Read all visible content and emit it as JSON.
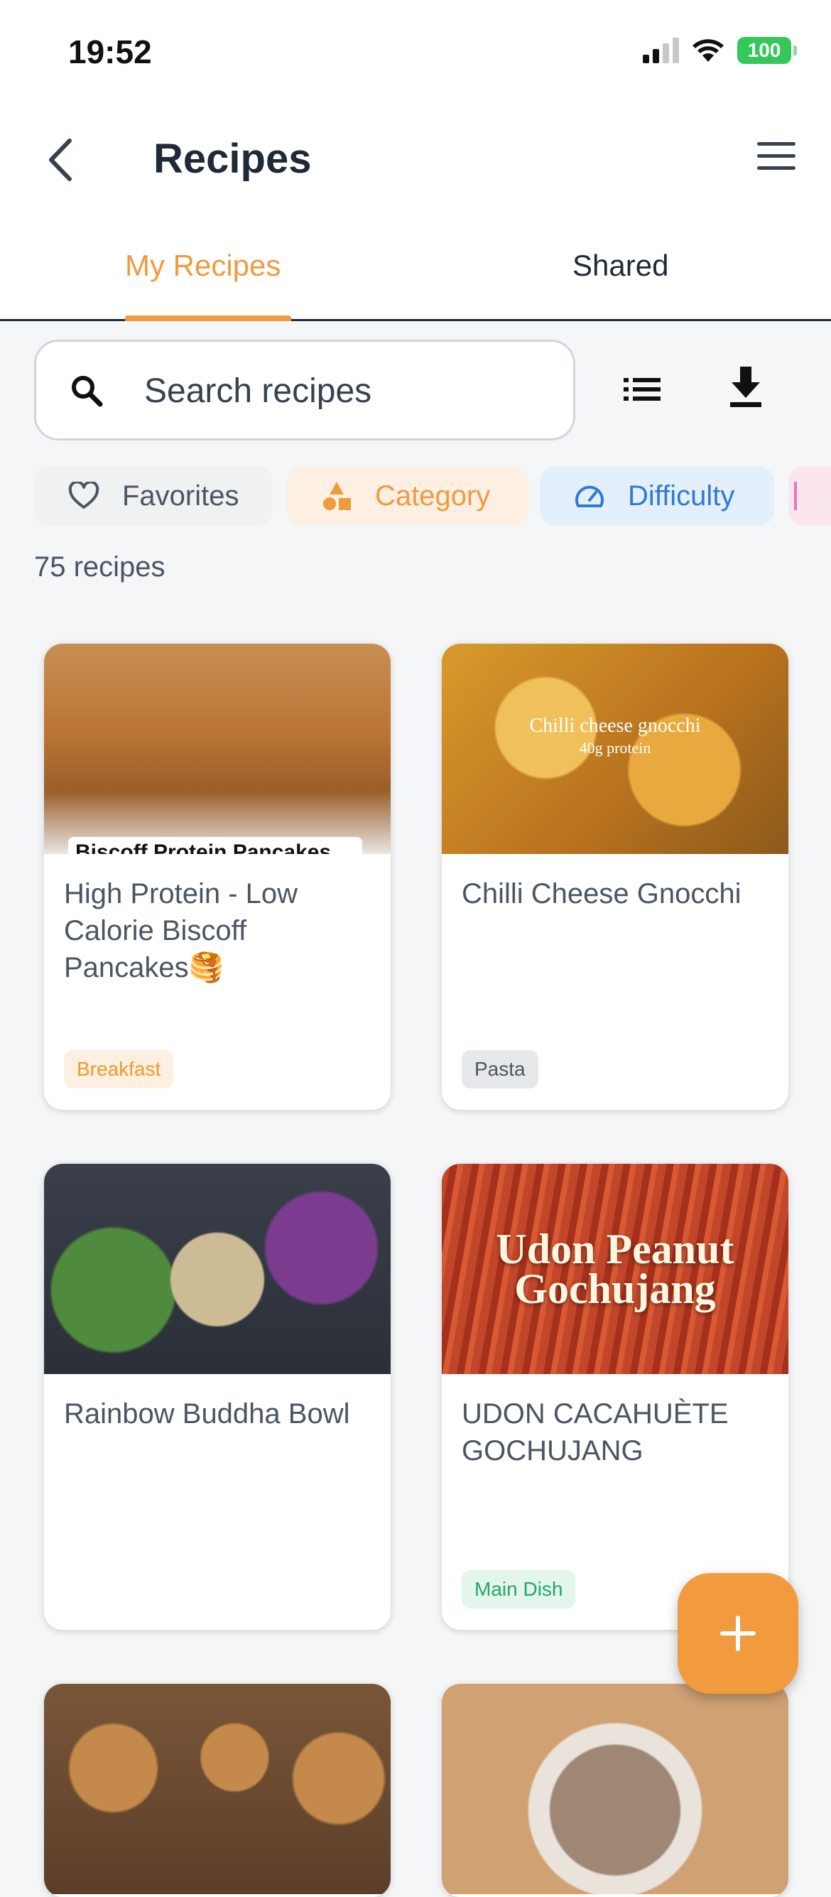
{
  "status_bar": {
    "time": "19:52",
    "battery": "100"
  },
  "header": {
    "title": "Recipes"
  },
  "tabs": [
    {
      "label": "My Recipes",
      "active": true
    },
    {
      "label": "Shared",
      "active": false
    }
  ],
  "search": {
    "placeholder": "Search recipes"
  },
  "filters": [
    {
      "label": "Favorites",
      "icon": "heart-icon"
    },
    {
      "label": "Category",
      "icon": "shapes-icon"
    },
    {
      "label": "Difficulty",
      "icon": "gauge-icon"
    }
  ],
  "recipe_count": "75 recipes",
  "recipes": [
    {
      "title": "High Protein - Low Calorie Biscoff Pancakes🥞",
      "tag": "Breakfast",
      "image_label": "Biscoff Protein Pancakes"
    },
    {
      "title": "Chilli Cheese Gnocchi",
      "tag": "Pasta",
      "image_title": "Chilli cheese gnocchi",
      "image_subtitle": "40g protein"
    },
    {
      "title": "Rainbow Buddha Bowl",
      "tag": ""
    },
    {
      "title": "UDON CACAHUÈTE GOCHUJANG",
      "tag": "Main Dish",
      "image_title": "Udon Peanut Gochujang"
    },
    {
      "title": "",
      "tag": ""
    },
    {
      "title": "",
      "tag": ""
    }
  ],
  "colors": {
    "accent": "#f29a3e",
    "difficulty": "#2f7bd1",
    "breakfast_tag": "#ef9a2d",
    "main_dish_tag": "#2aa56c"
  }
}
